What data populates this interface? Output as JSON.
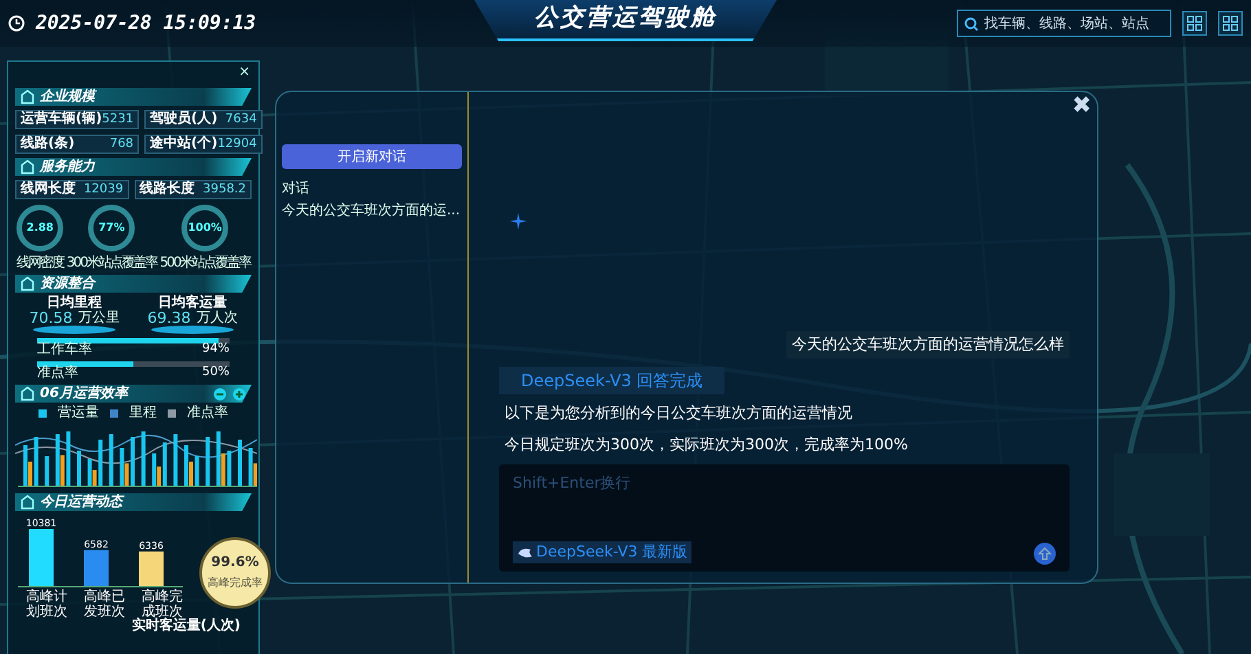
{
  "header": {
    "datetime": "2025-07-28 15:09:13",
    "title": "公交营运驾驶舱",
    "search": {
      "placeholder": "找车辆、线路、场站、站点"
    }
  },
  "left_panel": {
    "close": "×",
    "enterprise": {
      "title": "企业规模",
      "stats": [
        {
          "label": "运营车辆(辆)",
          "value": "5231"
        },
        {
          "label": "驾驶员(人)",
          "value": "7634"
        },
        {
          "label": "线路(条)",
          "value": "768"
        },
        {
          "label": "途中站(个)",
          "value": "12904"
        }
      ]
    },
    "service": {
      "title": "服务能力",
      "pairs": [
        {
          "label": "线网长度",
          "value": "12039"
        },
        {
          "label": "线路长度",
          "value": "3958.2"
        }
      ],
      "rings": [
        {
          "value": "2.88",
          "label": "线网密度"
        },
        {
          "value": "77%",
          "label": "300米站点覆盖率"
        },
        {
          "value": "100%",
          "label": "500米站点覆盖率"
        }
      ]
    },
    "resources": {
      "title": "资源整合",
      "metrics": [
        {
          "label": "日均里程",
          "value": "70.58",
          "unit": "万公里"
        },
        {
          "label": "日均客运量",
          "value": "69.38",
          "unit": "万人次"
        }
      ],
      "bars": [
        {
          "label": "工作车率",
          "level": 0.94,
          "reading": "94%"
        },
        {
          "label": "准点率",
          "level": 0.5,
          "reading": "50%"
        }
      ]
    },
    "efficiency": {
      "title": "06月运营效率",
      "legend": [
        {
          "label": "营运量",
          "color": "#19c6ef"
        },
        {
          "label": "里程",
          "color": "#3f86c8"
        },
        {
          "label": "准点率",
          "color": "#8d99a4"
        }
      ]
    },
    "today": {
      "title": "今日运营动态",
      "chart_data": {
        "type": "bar",
        "categories": [
          "高峰计划班次",
          "高峰已发班次",
          "高峰完成班次"
        ],
        "values": [
          10381,
          6582,
          6336
        ],
        "data_labels": true
      },
      "rate": {
        "value": "99.6%",
        "label": "高峰完成率"
      },
      "realtime_title": "实时客运量(人次)"
    }
  },
  "chat": {
    "close": "✖",
    "new_button": "开启新对话",
    "history_title": "对话",
    "history": [
      {
        "title": "今天的公交车班次方面的运..."
      }
    ],
    "messages": [
      {
        "kind": "user",
        "text": "今天的公交车班次方面的运营情况怎么样"
      },
      {
        "kind": "status",
        "text": "DeepSeek-V3 回答完成"
      },
      {
        "kind": "answer",
        "text": "以下是为您分析到的今日公交车班次方面的运营情况"
      },
      {
        "kind": "answer",
        "text": "今日规定班次为300次，实际班次为300次，完成率为100%"
      }
    ],
    "input": {
      "placeholder": "Shift+Enter换行",
      "model": "DeepSeek-V3 最新版"
    }
  }
}
